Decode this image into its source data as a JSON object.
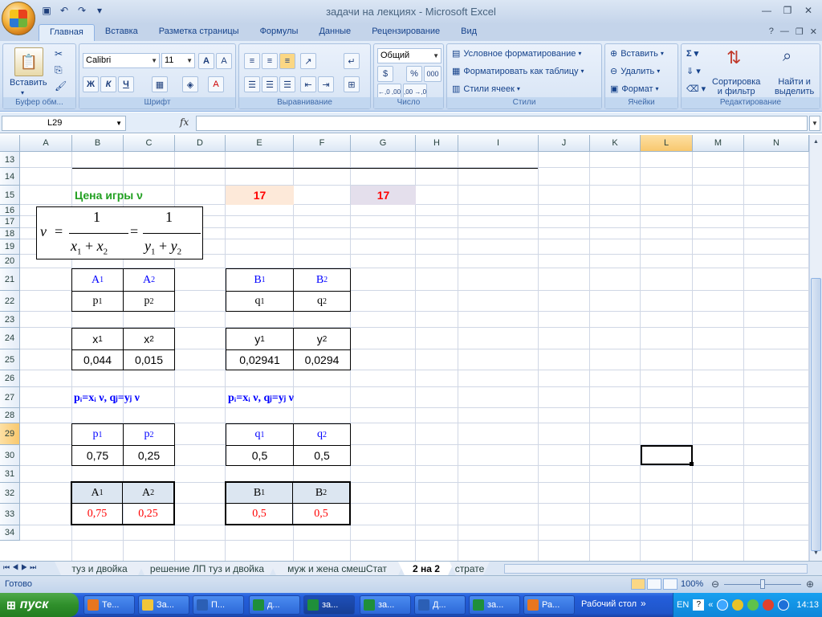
{
  "window": {
    "title": "задачи на лекциях - Microsoft Excel"
  },
  "ribbon": {
    "tabs": [
      "Главная",
      "Вставка",
      "Разметка страницы",
      "Формулы",
      "Данные",
      "Рецензирование",
      "Вид"
    ],
    "groups": {
      "clipboard": {
        "label": "Буфер обм...",
        "paste": "Вставить"
      },
      "font": {
        "label": "Шрифт",
        "font_name": "Calibri",
        "font_size": "11",
        "bold": "Ж",
        "italic": "К",
        "underline": "Ч"
      },
      "alignment": {
        "label": "Выравнивание"
      },
      "number": {
        "label": "Число",
        "format": "Общий",
        "percent": "%",
        "thousands": "000",
        "dec_inc": "←,0 ,00",
        "dec_dec": ",00 →,0"
      },
      "styles": {
        "label": "Стили",
        "conditional": "Условное форматирование",
        "format_table": "Форматировать как таблицу",
        "cell_styles": "Стили ячеек"
      },
      "cells": {
        "label": "Ячейки",
        "insert": "Вставить",
        "delete": "Удалить",
        "format": "Формат"
      },
      "editing": {
        "label": "Редактирование",
        "sort_line1": "Сортировка",
        "sort_line2": "и фильтр",
        "find_line1": "Найти и",
        "find_line2": "выделить"
      }
    }
  },
  "formula_bar": {
    "name_box": "L29",
    "fx": "fx",
    "value": ""
  },
  "columns": [
    "A",
    "B",
    "C",
    "D",
    "E",
    "F",
    "G",
    "H",
    "I",
    "J",
    "K",
    "L",
    "M",
    "N"
  ],
  "rows": [
    "13",
    "14",
    "15",
    "16",
    "17",
    "18",
    "19",
    "20",
    "21",
    "22",
    "23",
    "24",
    "25",
    "26",
    "27",
    "28",
    "29",
    "30",
    "31",
    "32",
    "33",
    "34"
  ],
  "sheet": {
    "price_label": "Цена игры ν",
    "price_e": "17",
    "price_g": "17",
    "formula": {
      "nu": "ν",
      "eq": "=",
      "one": "1",
      "x1": "x",
      "x2": "x",
      "y1": "y",
      "y2": "y",
      "sub1": "1",
      "sub2": "2",
      "plus": "+"
    },
    "row20": {
      "a1": "A",
      "a2": "A",
      "b1": "B",
      "b2": "B"
    },
    "row21": {
      "p1": "p",
      "p2": "p",
      "q1": "q",
      "q2": "q"
    },
    "row23": {
      "x1": "x",
      "x2": "x",
      "y1": "y",
      "y2": "y"
    },
    "row24": {
      "x1": "0,044",
      "x2": "0,015",
      "y1": "0,02941",
      "y2": "0,0294"
    },
    "row26": {
      "left": "pᵢ=xᵢ ν,   qⱼ=yⱼ ν",
      "right": "pᵢ=xᵢ ν,   qⱼ=yⱼ ν"
    },
    "row28": {
      "p1": "p",
      "p2": "p",
      "q1": "q",
      "q2": "q"
    },
    "row29": {
      "p1": "0,75",
      "p2": "0,25",
      "q1": "0,5",
      "q2": "0,5"
    },
    "row31": {
      "a1": "A",
      "a2": "A",
      "b1": "B",
      "b2": "B"
    },
    "row32": {
      "a1": "0,75",
      "a2": "0,25",
      "b1": "0,5",
      "b2": "0,5"
    },
    "sub1": "1",
    "sub2": "2"
  },
  "sheet_tabs": [
    "туз и двойка",
    "решение ЛП туз и двойка",
    "муж и жена смешСтат",
    "2 на 2",
    "страте"
  ],
  "status": {
    "ready": "Готово",
    "zoom": "100%"
  },
  "taskbar": {
    "start": "пуск",
    "buttons": [
      "Те...",
      "За...",
      "П...",
      "д...",
      "за...",
      "за...",
      "Д...",
      "за...",
      "Ра..."
    ],
    "desktop": "Рабочий стол",
    "lang": "EN",
    "time": "14:13"
  },
  "colors": {
    "accent_green": "#22a022",
    "red": "#ff0000",
    "blue": "#0000ff",
    "peach": "#fde9d9",
    "lavender": "#e4dfec",
    "header_fill": "#dce6f1"
  }
}
